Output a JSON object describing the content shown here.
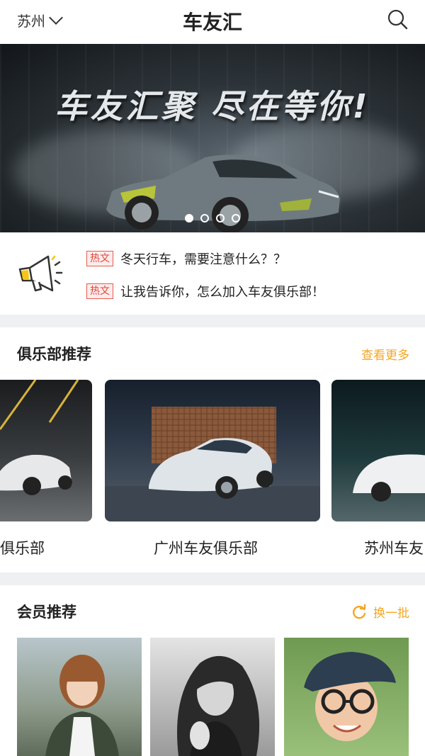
{
  "header": {
    "city": "苏州",
    "title": "车友汇"
  },
  "banner": {
    "text": "车友汇聚 尽在等你!",
    "slides": 4,
    "active_index": 0
  },
  "news": {
    "items": [
      {
        "tag": "热文",
        "text": "冬天行车，需要注意什么？？"
      },
      {
        "tag": "热文",
        "text": "让我告诉你，怎么加入车友俱乐部！"
      }
    ]
  },
  "clubs": {
    "title": "俱乐部推荐",
    "more": "查看更多",
    "items": [
      {
        "name": "俱乐部"
      },
      {
        "name": "广州车友俱乐部"
      },
      {
        "name": "苏州车友"
      }
    ]
  },
  "members": {
    "title": "会员推荐",
    "refresh": "换一批"
  },
  "colors": {
    "accent": "#f5a623",
    "tag_red": "#e0463a",
    "divider": "#eef0f2"
  }
}
